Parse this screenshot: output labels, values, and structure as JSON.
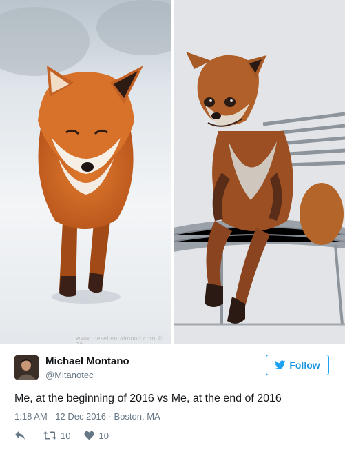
{
  "photos": {
    "left": {
      "watermark": "www.roeselienraimond.com © 20"
    }
  },
  "tweet": {
    "author_name": "Michael Montano",
    "author_handle": "@Mitanotec",
    "follow_label": "Follow",
    "text": "Me, at the beginning of 2016 vs Me, at the end of 2016",
    "meta": "1:18 AM - 12 Dec 2016 · Boston, MA",
    "retweet_count": "10",
    "like_count": "10"
  },
  "colors": {
    "accent": "#1da1f2",
    "muted": "#657786",
    "text": "#14171a"
  },
  "icons": {
    "reply": "reply-icon",
    "retweet": "retweet-icon",
    "like": "heart-icon",
    "follow": "twitter-bird-icon"
  }
}
